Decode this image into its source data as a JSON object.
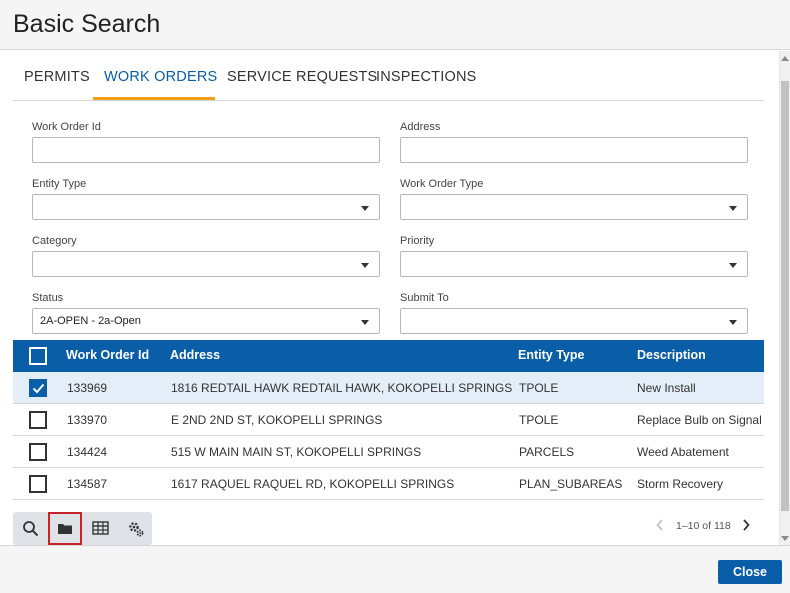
{
  "dialog": {
    "title": "Basic Search"
  },
  "tabs": [
    {
      "label": "PERMITS"
    },
    {
      "label": "WORK ORDERS",
      "active": true
    },
    {
      "label": "SERVICE REQUESTS"
    },
    {
      "label": "INSPECTIONS"
    }
  ],
  "form": {
    "work_order_id": {
      "label": "Work Order Id",
      "value": ""
    },
    "address": {
      "label": "Address",
      "value": ""
    },
    "entity_type": {
      "label": "Entity Type",
      "value": ""
    },
    "work_order_type": {
      "label": "Work Order Type",
      "value": ""
    },
    "category": {
      "label": "Category",
      "value": ""
    },
    "priority": {
      "label": "Priority",
      "value": ""
    },
    "status": {
      "label": "Status",
      "value": "2A-OPEN - 2a-Open"
    },
    "submit_to": {
      "label": "Submit To",
      "value": ""
    }
  },
  "grid": {
    "columns": [
      "Work Order Id",
      "Address",
      "Entity Type",
      "Description"
    ],
    "rows": [
      {
        "id": "133969",
        "address": "1816 REDTAIL HAWK REDTAIL HAWK, KOKOPELLI SPRINGS",
        "entity": "TPOLE",
        "description": "New Install",
        "checked": true
      },
      {
        "id": "133970",
        "address": "E 2ND 2ND ST, KOKOPELLI SPRINGS",
        "entity": "TPOLE",
        "description": "Replace Bulb on Signal",
        "checked": false
      },
      {
        "id": "134424",
        "address": "515 W MAIN MAIN ST, KOKOPELLI SPRINGS",
        "entity": "PARCELS",
        "description": "Weed Abatement",
        "checked": false
      },
      {
        "id": "134587",
        "address": "1617 RAQUEL RAQUEL RD, KOKOPELLI SPRINGS",
        "entity": "PLAN_SUBAREAS",
        "description": "Storm Recovery",
        "checked": false
      }
    ]
  },
  "toolbar": {
    "icons": [
      "search-icon",
      "folder-icon",
      "table-icon",
      "gears-icon"
    ],
    "selected": "folder-icon"
  },
  "pager": {
    "text": "1–10 of 118"
  },
  "footer": {
    "close_label": "Close"
  },
  "colors": {
    "primary": "#0a5ea8",
    "accent": "#f0a01a",
    "highlight": "#c8232a"
  }
}
